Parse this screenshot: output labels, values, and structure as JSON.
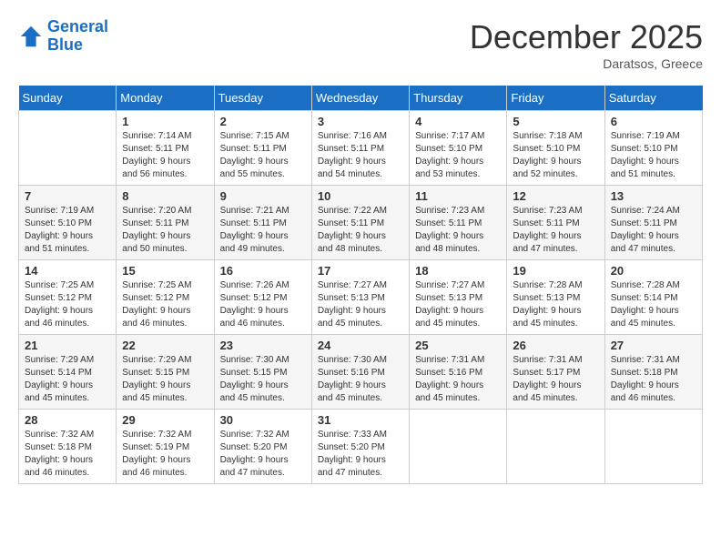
{
  "header": {
    "logo_line1": "General",
    "logo_line2": "Blue",
    "month": "December 2025",
    "location": "Daratsos, Greece"
  },
  "weekdays": [
    "Sunday",
    "Monday",
    "Tuesday",
    "Wednesday",
    "Thursday",
    "Friday",
    "Saturday"
  ],
  "weeks": [
    [
      {
        "day": "",
        "info": ""
      },
      {
        "day": "1",
        "info": "Sunrise: 7:14 AM\nSunset: 5:11 PM\nDaylight: 9 hours\nand 56 minutes."
      },
      {
        "day": "2",
        "info": "Sunrise: 7:15 AM\nSunset: 5:11 PM\nDaylight: 9 hours\nand 55 minutes."
      },
      {
        "day": "3",
        "info": "Sunrise: 7:16 AM\nSunset: 5:11 PM\nDaylight: 9 hours\nand 54 minutes."
      },
      {
        "day": "4",
        "info": "Sunrise: 7:17 AM\nSunset: 5:10 PM\nDaylight: 9 hours\nand 53 minutes."
      },
      {
        "day": "5",
        "info": "Sunrise: 7:18 AM\nSunset: 5:10 PM\nDaylight: 9 hours\nand 52 minutes."
      },
      {
        "day": "6",
        "info": "Sunrise: 7:19 AM\nSunset: 5:10 PM\nDaylight: 9 hours\nand 51 minutes."
      }
    ],
    [
      {
        "day": "7",
        "info": "Sunrise: 7:19 AM\nSunset: 5:10 PM\nDaylight: 9 hours\nand 51 minutes."
      },
      {
        "day": "8",
        "info": "Sunrise: 7:20 AM\nSunset: 5:11 PM\nDaylight: 9 hours\nand 50 minutes."
      },
      {
        "day": "9",
        "info": "Sunrise: 7:21 AM\nSunset: 5:11 PM\nDaylight: 9 hours\nand 49 minutes."
      },
      {
        "day": "10",
        "info": "Sunrise: 7:22 AM\nSunset: 5:11 PM\nDaylight: 9 hours\nand 48 minutes."
      },
      {
        "day": "11",
        "info": "Sunrise: 7:23 AM\nSunset: 5:11 PM\nDaylight: 9 hours\nand 48 minutes."
      },
      {
        "day": "12",
        "info": "Sunrise: 7:23 AM\nSunset: 5:11 PM\nDaylight: 9 hours\nand 47 minutes."
      },
      {
        "day": "13",
        "info": "Sunrise: 7:24 AM\nSunset: 5:11 PM\nDaylight: 9 hours\nand 47 minutes."
      }
    ],
    [
      {
        "day": "14",
        "info": "Sunrise: 7:25 AM\nSunset: 5:12 PM\nDaylight: 9 hours\nand 46 minutes."
      },
      {
        "day": "15",
        "info": "Sunrise: 7:25 AM\nSunset: 5:12 PM\nDaylight: 9 hours\nand 46 minutes."
      },
      {
        "day": "16",
        "info": "Sunrise: 7:26 AM\nSunset: 5:12 PM\nDaylight: 9 hours\nand 46 minutes."
      },
      {
        "day": "17",
        "info": "Sunrise: 7:27 AM\nSunset: 5:13 PM\nDaylight: 9 hours\nand 45 minutes."
      },
      {
        "day": "18",
        "info": "Sunrise: 7:27 AM\nSunset: 5:13 PM\nDaylight: 9 hours\nand 45 minutes."
      },
      {
        "day": "19",
        "info": "Sunrise: 7:28 AM\nSunset: 5:13 PM\nDaylight: 9 hours\nand 45 minutes."
      },
      {
        "day": "20",
        "info": "Sunrise: 7:28 AM\nSunset: 5:14 PM\nDaylight: 9 hours\nand 45 minutes."
      }
    ],
    [
      {
        "day": "21",
        "info": "Sunrise: 7:29 AM\nSunset: 5:14 PM\nDaylight: 9 hours\nand 45 minutes."
      },
      {
        "day": "22",
        "info": "Sunrise: 7:29 AM\nSunset: 5:15 PM\nDaylight: 9 hours\nand 45 minutes."
      },
      {
        "day": "23",
        "info": "Sunrise: 7:30 AM\nSunset: 5:15 PM\nDaylight: 9 hours\nand 45 minutes."
      },
      {
        "day": "24",
        "info": "Sunrise: 7:30 AM\nSunset: 5:16 PM\nDaylight: 9 hours\nand 45 minutes."
      },
      {
        "day": "25",
        "info": "Sunrise: 7:31 AM\nSunset: 5:16 PM\nDaylight: 9 hours\nand 45 minutes."
      },
      {
        "day": "26",
        "info": "Sunrise: 7:31 AM\nSunset: 5:17 PM\nDaylight: 9 hours\nand 45 minutes."
      },
      {
        "day": "27",
        "info": "Sunrise: 7:31 AM\nSunset: 5:18 PM\nDaylight: 9 hours\nand 46 minutes."
      }
    ],
    [
      {
        "day": "28",
        "info": "Sunrise: 7:32 AM\nSunset: 5:18 PM\nDaylight: 9 hours\nand 46 minutes."
      },
      {
        "day": "29",
        "info": "Sunrise: 7:32 AM\nSunset: 5:19 PM\nDaylight: 9 hours\nand 46 minutes."
      },
      {
        "day": "30",
        "info": "Sunrise: 7:32 AM\nSunset: 5:20 PM\nDaylight: 9 hours\nand 47 minutes."
      },
      {
        "day": "31",
        "info": "Sunrise: 7:33 AM\nSunset: 5:20 PM\nDaylight: 9 hours\nand 47 minutes."
      },
      {
        "day": "",
        "info": ""
      },
      {
        "day": "",
        "info": ""
      },
      {
        "day": "",
        "info": ""
      }
    ]
  ]
}
